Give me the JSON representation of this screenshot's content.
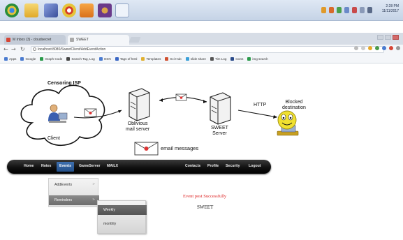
{
  "taskbar": {
    "apps": [
      {
        "name": "chrome",
        "color": "#2a8d3c"
      },
      {
        "name": "folder",
        "color": "#f0c040"
      },
      {
        "name": "eclipse",
        "color": "#5a6fb8"
      },
      {
        "name": "chrome-alt",
        "color": "#d43b2b"
      },
      {
        "name": "office",
        "color": "#e88a1a"
      },
      {
        "name": "media",
        "color": "#6a3a8a"
      },
      {
        "name": "notepad",
        "color": "#d6e2f2"
      }
    ],
    "clock_time": "2:28 PM",
    "clock_date": "11/11/2017"
  },
  "browser": {
    "tabs": [
      {
        "label": "M Inbox (3) - cloudsecret",
        "color": "#d64535"
      },
      {
        "label": "SWEET",
        "color": "#888888"
      }
    ],
    "url": "localhost:8080/SweetClient/AddEventAction",
    "bookmarks": [
      {
        "label": "Apps",
        "color": "#4a7bd0"
      },
      {
        "label": "Google",
        "color": "#4a7bd0"
      },
      {
        "label": "Graph Code",
        "color": "#2a9a4a"
      },
      {
        "label": "Search Tag, Log",
        "color": "#444444"
      },
      {
        "label": "OSN",
        "color": "#4a7bd0"
      },
      {
        "label": "Tags of html",
        "color": "#3a66c4"
      },
      {
        "label": "Templates",
        "color": "#e0b030"
      },
      {
        "label": "Sci-Hub",
        "color": "#d05030"
      },
      {
        "label": "slide share",
        "color": "#3aa0d8"
      },
      {
        "label": "Tim Log",
        "color": "#555555"
      },
      {
        "label": "Icons",
        "color": "#2a4a8a"
      },
      {
        "label": "img search",
        "color": "#2a9a4a"
      }
    ]
  },
  "diagram": {
    "censoring_isp": "Censoring ISP",
    "client": "Client",
    "oblivious_server": "Oblivious\nmail server",
    "sweet_server": "SWEET\nServer",
    "http": "HTTP",
    "blocked_destination": "Blocked\ndestination",
    "email_messages": "email messages"
  },
  "menu": {
    "items": [
      "Home",
      "Notes",
      "Events",
      "GameServer",
      "MAILX",
      "Contacts",
      "Profile",
      "Security",
      "Logout"
    ],
    "active": "Events"
  },
  "dropdown": {
    "items": [
      "AddEvents",
      "Reminders"
    ]
  },
  "submenu": {
    "items": [
      "Weekly",
      "monthly"
    ]
  },
  "status": {
    "success_message": "Event post Successfully",
    "brand": "SWEET"
  }
}
